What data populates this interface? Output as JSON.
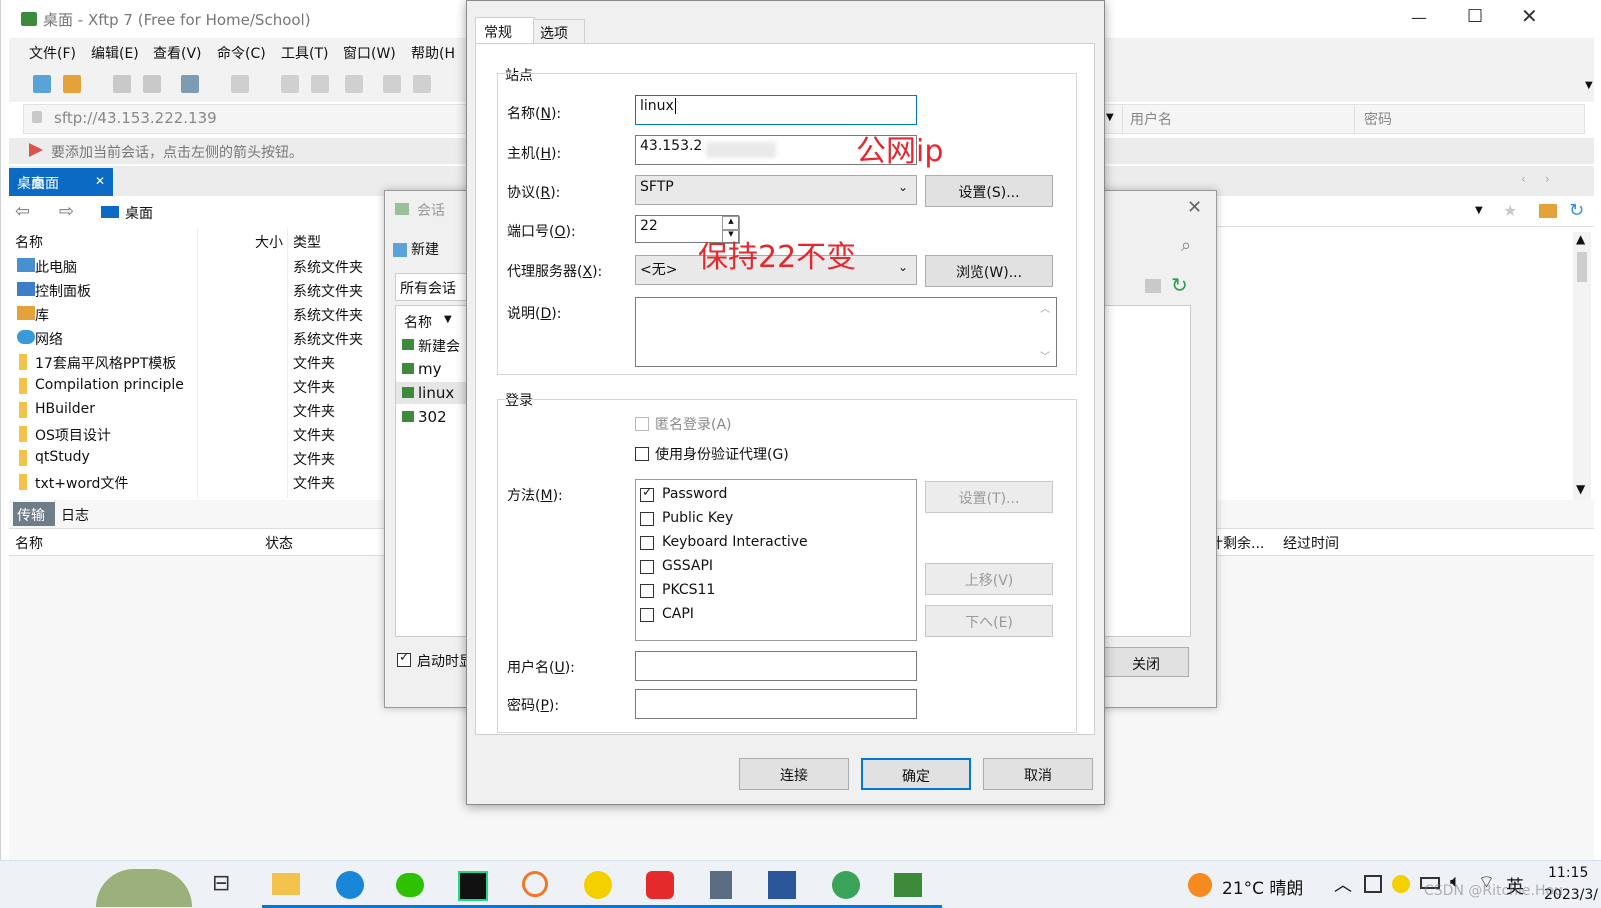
{
  "main": {
    "title": "桌面 - Xftp 7 (Free for Home/School)",
    "menu": [
      "文件(F)",
      "编辑(E)",
      "查看(V)",
      "命令(C)",
      "工具(T)",
      "窗口(W)",
      "帮助(H"
    ],
    "address": "sftp://43.153.222.139",
    "hint": "要添加当前会话，点击左侧的箭头按钮。",
    "tab": "桌面",
    "path": "桌面",
    "right_headers": {
      "user": "用户名",
      "password": "密码"
    },
    "file_headers": {
      "name": "名称",
      "size": "大小",
      "type": "类型"
    },
    "files": [
      {
        "name": "此电脑",
        "type": "系统文件夹"
      },
      {
        "name": "控制面板",
        "type": "系统文件夹"
      },
      {
        "name": "库",
        "type": "系统文件夹"
      },
      {
        "name": "网络",
        "type": "系统文件夹"
      },
      {
        "name": "17套扁平风格PPT模板",
        "type": "文件夹"
      },
      {
        "name": "Compilation principle",
        "type": "文件夹"
      },
      {
        "name": "HBuilder",
        "type": "文件夹"
      },
      {
        "name": "OS项目设计",
        "type": "文件夹"
      },
      {
        "name": "qtStudy",
        "type": "文件夹"
      },
      {
        "name": "txt+word文件",
        "type": "文件夹"
      }
    ],
    "bottom_tabs": {
      "transfer": "传输",
      "log": "日志"
    },
    "transfer_headers": {
      "name": "名称",
      "status": "状态",
      "remaining": "计剩余...",
      "elapsed": "经过时间"
    }
  },
  "session": {
    "title": "会话",
    "new_button": "新建",
    "all_sessions": "所有会话",
    "name_header": "名称",
    "items": [
      "新建会",
      "my",
      "linux",
      "302"
    ],
    "startup_checkbox": "启动时显",
    "close_button": "关闭"
  },
  "props": {
    "tabs": {
      "general": "常规",
      "options": "选项"
    },
    "site_group": "站点",
    "name_label": "名称(",
    "name_key": "N",
    "name_end": "):",
    "name_value": "linux",
    "host_label": "主机(",
    "host_key": "H",
    "host_end": "):",
    "host_value": "43.153.2",
    "protocol_label": "协议(",
    "protocol_key": "R",
    "protocol_end": "):",
    "protocol_value": "SFTP",
    "settings_button": "设置(S)...",
    "port_label": "端口号(",
    "port_key": "O",
    "port_end": "):",
    "port_value": "22",
    "proxy_label": "代理服务器(",
    "proxy_key": "X",
    "proxy_end": "):",
    "proxy_value": "<无>",
    "browse_button": "浏览(W)...",
    "desc_label": "说明(",
    "desc_key": "D",
    "desc_end": "):",
    "login_group": "登录",
    "anonymous": "匿名登录(A)",
    "agent": "使用身份验证代理(G)",
    "method_label": "方法(",
    "method_key": "M",
    "method_end": "):",
    "methods": [
      {
        "label": "Password",
        "checked": true
      },
      {
        "label": "Public Key",
        "checked": false
      },
      {
        "label": "Keyboard Interactive",
        "checked": false
      },
      {
        "label": "GSSAPI",
        "checked": false
      },
      {
        "label": "PKCS11",
        "checked": false
      },
      {
        "label": "CAPI",
        "checked": false
      }
    ],
    "method_settings": "设置(T)...",
    "move_up": "上移(V)",
    "move_down": "下へ(E)",
    "user_label": "用户名(",
    "user_key": "U",
    "user_end": "):",
    "pass_label": "密码(",
    "pass_key": "P",
    "pass_end": "):",
    "connect_button": "连接",
    "ok_button": "确定",
    "cancel_button": "取消"
  },
  "annotations": {
    "public_ip": "公网ip",
    "keep_port": "保持22不变"
  },
  "taskbar": {
    "weather": "21°C 晴朗",
    "ime": "英",
    "time": "11:15",
    "date": "2023/3/",
    "watermark": "CSDN @Ritchie.Hou"
  },
  "colors": {
    "accent": "#0b6bc4",
    "annotation": "#e8262d",
    "focus": "#0078d7"
  }
}
